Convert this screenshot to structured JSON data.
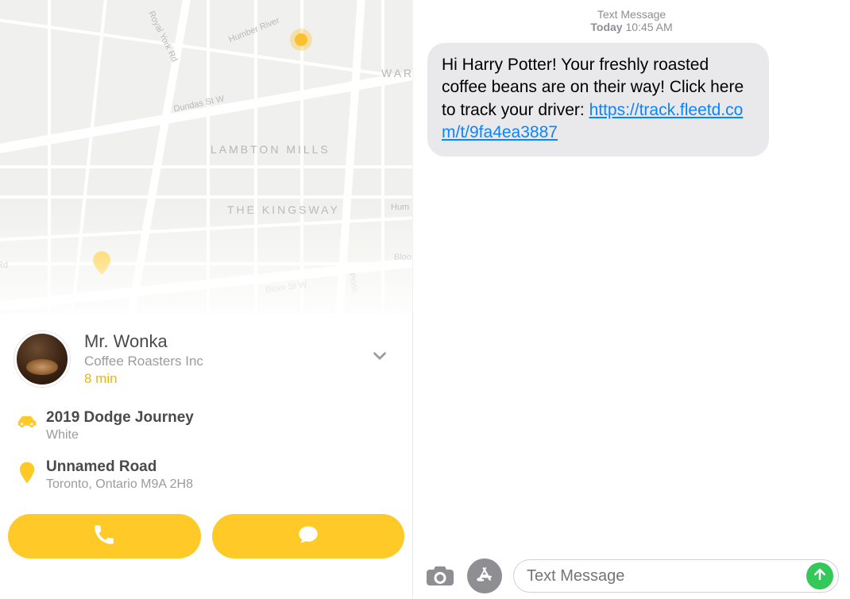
{
  "colors": {
    "accent": "#ffc928",
    "eta": "#f0b400",
    "bubble": "#e9e9eb",
    "link": "#0b84ff",
    "send": "#34c759"
  },
  "map": {
    "neighborhoods": {
      "lambton": "LAMBTON MILLS",
      "kingsway": "THE KINGSWAY",
      "warden": "WARI"
    },
    "streets": {
      "royal_york": "Royal York Rd",
      "dundas": "Dundas St W",
      "humber": "Humber River",
      "bloor": "Bloor St W",
      "prince": "Princ",
      "rd": "Rd",
      "hum": "Hum",
      "bloo": "Bloo"
    }
  },
  "driver": {
    "name": "Mr. Wonka",
    "company": "Coffee Roasters Inc",
    "eta": "8 min"
  },
  "vehicle": {
    "title": "2019 Dodge Journey",
    "subtitle": "White"
  },
  "destination": {
    "title": "Unnamed Road",
    "subtitle": "Toronto, Ontario M9A 2H8"
  },
  "sms": {
    "header_line": "Text Message",
    "today_label": "Today",
    "time": "10:45 AM",
    "body_prefix": "Hi Harry Potter! Your freshly roasted coffee beans are on their way! Click here to track your driver: ",
    "link_text": "https://track.fleetd.com/t/9fa4ea3887",
    "link_href": "https://track.fleetd.com/t/9fa4ea3887"
  },
  "composer": {
    "placeholder": "Text Message"
  }
}
